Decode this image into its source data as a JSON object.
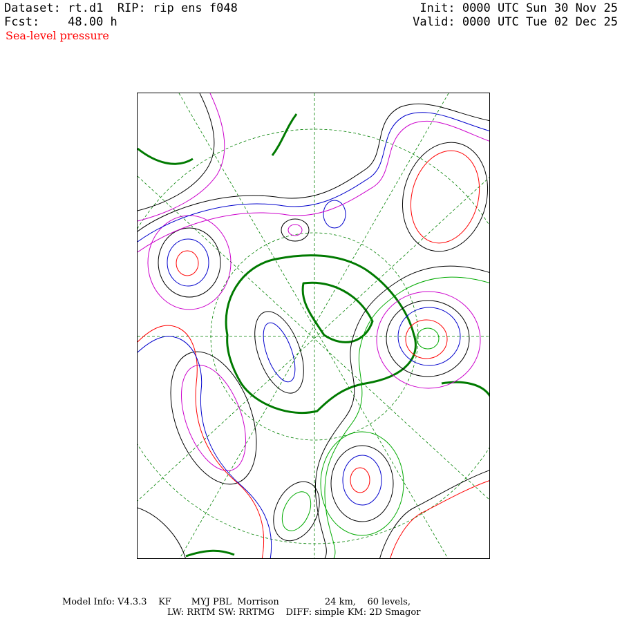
{
  "header": {
    "dataset_label": "Dataset:",
    "dataset_value": "rt.d1",
    "rip_label": "RIP:",
    "rip_value": "rip ens f048",
    "fcst_label": "Fcst:",
    "fcst_value": "48.00 h",
    "init_label": "Init:",
    "init_value": "0000 UTC Sun 30 Nov 25",
    "valid_label": "Valid:",
    "valid_value": "0000 UTC Tue 02 Dec 25"
  },
  "field": {
    "name": "Sea-level pressure",
    "color": "#ff0000"
  },
  "map": {
    "projection": "polar-stereographic",
    "ensemble_member_colors": [
      "#000000",
      "#0000cc",
      "#ff0000",
      "#00aa00",
      "#cc00cc"
    ],
    "coastline_color": "#007a00",
    "grid_color": "#008000"
  },
  "footer": {
    "line1": "Model Info: V4.3.3    KF       MYJ PBL  Morrison                24 km,    60 levels,",
    "line2": "LW: RRTM SW: RRTMG    DIFF: simple KM: 2D Smagor"
  }
}
